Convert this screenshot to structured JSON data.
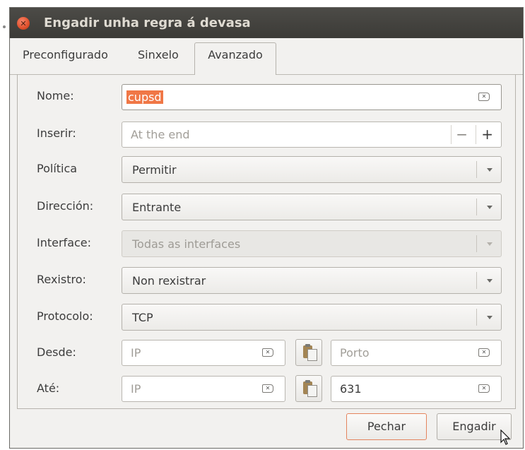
{
  "window": {
    "title": "Engadir unha regra á devasa"
  },
  "tabs": [
    {
      "label": "Preconfigurado",
      "active": false
    },
    {
      "label": "Sinxelo",
      "active": false
    },
    {
      "label": "Avanzado",
      "active": true
    }
  ],
  "form": {
    "name": {
      "label": "Nome:",
      "value": "cupsd"
    },
    "insert": {
      "label": "Inserir:",
      "placeholder": "At the end",
      "minus": "−",
      "plus": "+"
    },
    "policy": {
      "label": "Política",
      "value": "Permitir"
    },
    "direction": {
      "label": "Dirección:",
      "value": "Entrante"
    },
    "interface": {
      "label": "Interface:",
      "value": "Todas as interfaces"
    },
    "log": {
      "label": "Rexistro:",
      "value": "Non rexistrar"
    },
    "protocol": {
      "label": "Protocolo:",
      "value": "TCP"
    },
    "from": {
      "label": "Desde:",
      "ip_placeholder": "IP",
      "port_placeholder": "Porto"
    },
    "to": {
      "label": "Até:",
      "ip_placeholder": "IP",
      "port_value": "631"
    }
  },
  "buttons": {
    "close": "Pechar",
    "add": "Engadir"
  },
  "colors": {
    "accent": "#f07746",
    "titlebar": "#3c3b37",
    "window_bg": "#f2f1ef"
  },
  "icons": {
    "close": "close-icon",
    "clear": "clear-text-icon",
    "dropdown": "chevron-down-icon",
    "paste": "paste-icon",
    "cursor": "mouse-pointer-icon"
  }
}
